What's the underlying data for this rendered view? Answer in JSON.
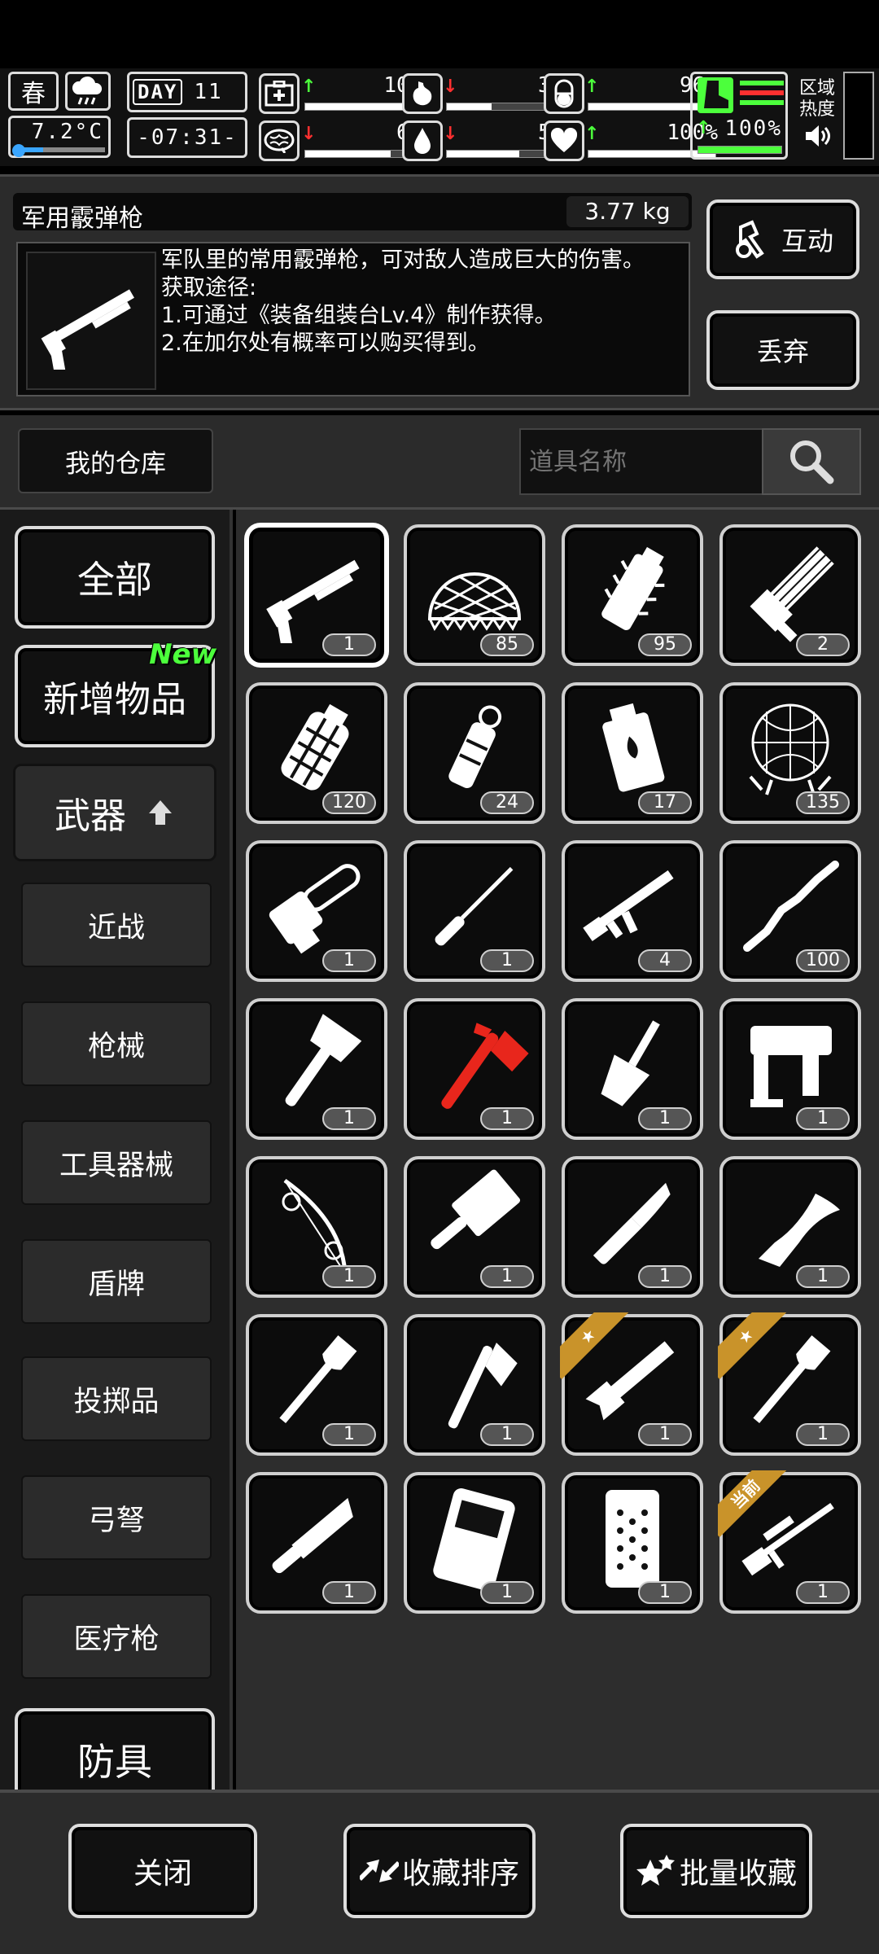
{
  "hud": {
    "season": "春",
    "temperature": "7.2°C",
    "day_label": "DAY",
    "day_number": "11",
    "clock": "-07:31-",
    "stats": [
      {
        "icon": "medkit-icon",
        "arrow": "↑",
        "arrow_color": "#4cff3c",
        "value": "100%",
        "level": 1.0
      },
      {
        "icon": "stomach-icon",
        "arrow": "↓",
        "arrow_color": "#ff3030",
        "value": "35%",
        "level": 0.35
      },
      {
        "icon": "pill-icon",
        "arrow": "↑",
        "arrow_color": "#4cff3c",
        "value": "96%",
        "level": 0.96
      },
      {
        "icon": "brain-icon",
        "arrow": "↓",
        "arrow_color": "#ff3030",
        "value": "67%",
        "level": 0.67
      },
      {
        "icon": "water-drop-icon",
        "arrow": "↓",
        "arrow_color": "#ff3030",
        "value": "57%",
        "level": 0.57
      },
      {
        "icon": "heart-icon",
        "arrow": "↑",
        "arrow_color": "#4cff3c",
        "value": "100%",
        "level": 1.0
      }
    ],
    "stamina": {
      "arrow": "↑",
      "value": "100%",
      "level": 1.0,
      "color": "#4cff3c"
    },
    "zone_heat_label": "区域\n热度"
  },
  "detail": {
    "item_name": "军用霰弹枪",
    "weight": "3.77 kg",
    "description": "军队里的常用霰弹枪，可对敌人造成巨大的伤害。\n获取途径:\n1.可通过《装备组装台Lv.4》制作获得。\n2.在加尔处有概率可以购买得到。",
    "interact_label": "互动",
    "discard_label": "丢弃"
  },
  "warehouse": {
    "title": "我的仓库",
    "search_placeholder": "道具名称"
  },
  "sidebar": {
    "all": "全部",
    "new_items": "新增物品",
    "new_tag": "New",
    "weapons": "武器",
    "subs": [
      "近战",
      "枪械",
      "工具器械",
      "盾牌",
      "投掷品",
      "弓弩",
      "医疗枪"
    ],
    "armor": "防具"
  },
  "items": [
    {
      "name": "shotgun",
      "count": "1",
      "selected": true
    },
    {
      "name": "net",
      "count": "85"
    },
    {
      "name": "spike-grenade",
      "count": "95"
    },
    {
      "name": "minigun",
      "count": "2"
    },
    {
      "name": "frag-grenade",
      "count": "120"
    },
    {
      "name": "stun-grenade",
      "count": "24"
    },
    {
      "name": "incendiary-grenade",
      "count": "17"
    },
    {
      "name": "trap-net",
      "count": "135"
    },
    {
      "name": "chainsaw",
      "count": "1"
    },
    {
      "name": "screwdriver",
      "count": "1"
    },
    {
      "name": "assault-rifle",
      "count": "4"
    },
    {
      "name": "wooden-stick",
      "count": "100"
    },
    {
      "name": "hatchet",
      "count": "1"
    },
    {
      "name": "red-fire-axe",
      "count": "1",
      "color": "#e8261c"
    },
    {
      "name": "trowel",
      "count": "1"
    },
    {
      "name": "nail-gun",
      "count": "1"
    },
    {
      "name": "compound-bow",
      "count": "1"
    },
    {
      "name": "cleaver",
      "count": "1"
    },
    {
      "name": "folding-knife",
      "count": "1"
    },
    {
      "name": "kukri",
      "count": "1"
    },
    {
      "name": "shovel",
      "count": "1"
    },
    {
      "name": "axe",
      "count": "1"
    },
    {
      "name": "wrench-blade",
      "count": "1",
      "ribbon": "★"
    },
    {
      "name": "starred-shovel",
      "count": "1",
      "ribbon": "★"
    },
    {
      "name": "machete",
      "count": "1"
    },
    {
      "name": "riot-shield",
      "count": "1"
    },
    {
      "name": "studded-shield",
      "count": "1"
    },
    {
      "name": "sniper-rifle",
      "count": "1",
      "ribbon": "当前"
    }
  ],
  "bottom": {
    "close": "关闭",
    "sort_favorites": "收藏排序",
    "batch_favorite": "批量收藏"
  }
}
